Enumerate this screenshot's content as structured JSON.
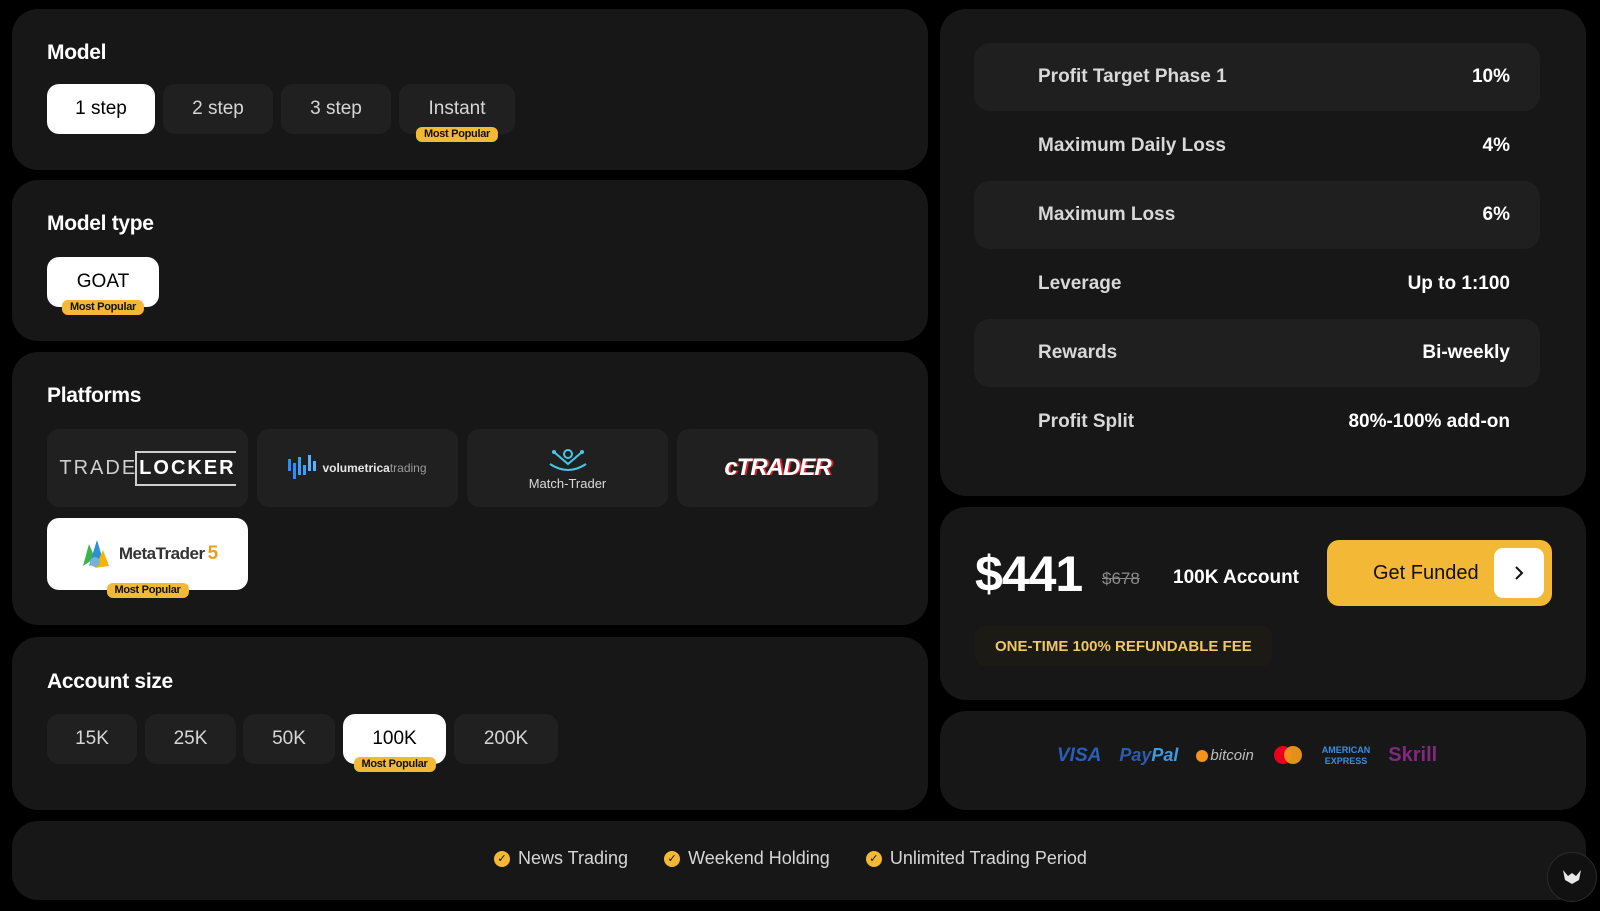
{
  "model": {
    "title": "Model",
    "options": [
      {
        "label": "1 step"
      },
      {
        "label": "2 step"
      },
      {
        "label": "3 step"
      },
      {
        "label": "Instant",
        "badge": "Most Popular"
      }
    ]
  },
  "model_type": {
    "title": "Model type",
    "options": [
      {
        "label": "GOAT",
        "badge": "Most Popular"
      }
    ]
  },
  "platforms": {
    "title": "Platforms",
    "items": [
      {
        "name": "TradeLocker",
        "logo_left": "TRADE",
        "logo_right": "LOCKER"
      },
      {
        "name": "Volumetrica Trading",
        "logo_a": "volumetrica",
        "logo_b": "trading"
      },
      {
        "name": "Match-Trader",
        "logo": "Match-Trader"
      },
      {
        "name": "cTrader",
        "logo": "cTRADER"
      },
      {
        "name": "MetaTrader 5",
        "logo_a": "MetaTrader",
        "logo_b": "5",
        "badge": "Most Popular"
      }
    ]
  },
  "account_size": {
    "title": "Account size",
    "options": [
      {
        "label": "15K"
      },
      {
        "label": "25K"
      },
      {
        "label": "50K"
      },
      {
        "label": "100K",
        "badge": "Most Popular"
      },
      {
        "label": "200K"
      }
    ]
  },
  "specs": [
    {
      "label": "Profit Target Phase 1",
      "value": "10%"
    },
    {
      "label": "Maximum Daily Loss",
      "value": "4%"
    },
    {
      "label": "Maximum Loss",
      "value": "6%"
    },
    {
      "label": "Leverage",
      "value": "Up to 1:100"
    },
    {
      "label": "Rewards",
      "value": "Bi-weekly"
    },
    {
      "label": "Profit Split",
      "value": "80%-100% add-on"
    }
  ],
  "pricing": {
    "price": "$441",
    "old_price": "$678",
    "account": "100K Account",
    "cta": "Get Funded",
    "fee_note": "ONE-TIME 100% REFUNDABLE FEE"
  },
  "payments": {
    "visa": "VISA",
    "paypal_a": "Pay",
    "paypal_b": "Pal",
    "bitcoin": "bitcoin",
    "amex_a": "AMERICAN",
    "amex_b": "EXPRESS",
    "skrill": "Skrill"
  },
  "features": [
    "News Trading",
    "Weekend Holding",
    "Unlimited Trading Period"
  ],
  "colors": {
    "accent": "#f3b835",
    "card": "#171717",
    "pill": "#202020"
  }
}
